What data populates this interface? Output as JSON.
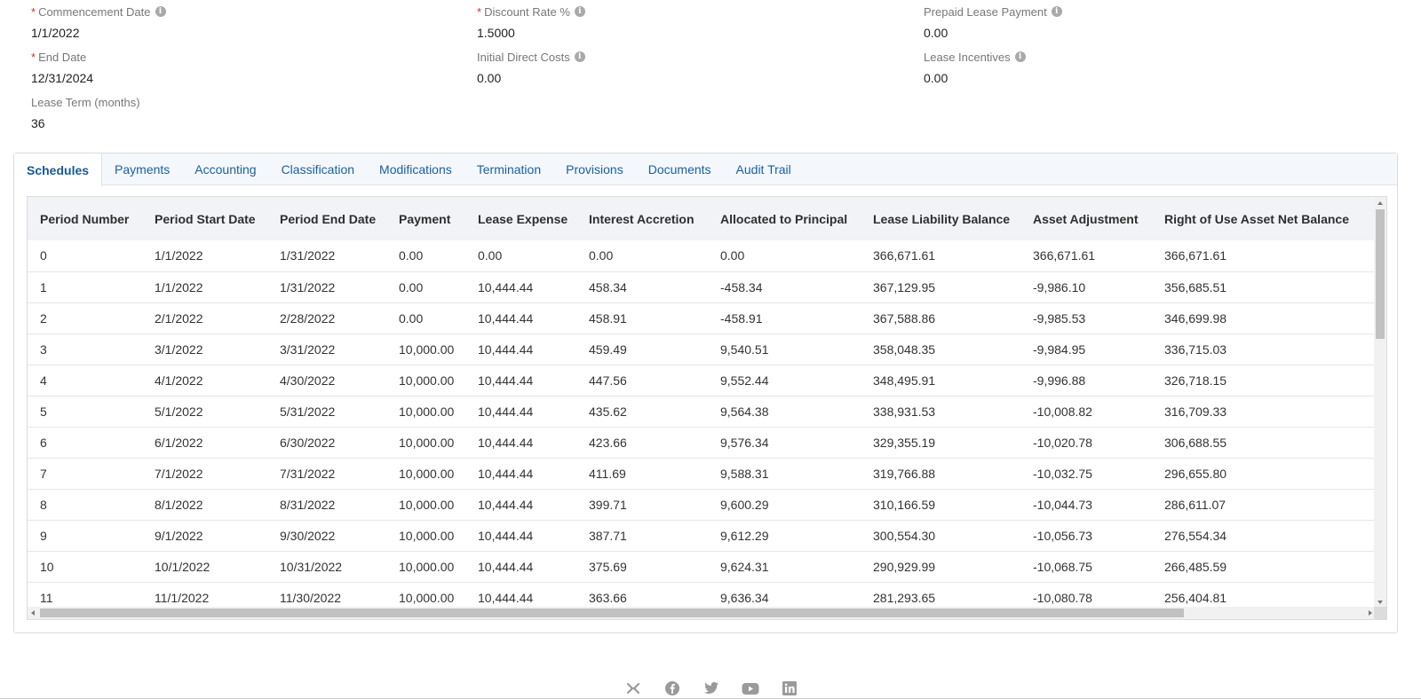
{
  "fields": {
    "commencement_date": {
      "label": "Commencement Date",
      "value": "1/1/2022"
    },
    "discount_rate": {
      "label": "Discount Rate %",
      "value": "1.5000"
    },
    "prepaid_lease_payment": {
      "label": "Prepaid Lease Payment",
      "value": "0.00"
    },
    "end_date": {
      "label": "End Date",
      "value": "12/31/2024"
    },
    "initial_direct_costs": {
      "label": "Initial Direct Costs",
      "value": "0.00"
    },
    "lease_incentives": {
      "label": "Lease Incentives",
      "value": "0.00"
    },
    "lease_term": {
      "label": "Lease Term (months)",
      "value": "36"
    },
    "required_marker": "*",
    "info_glyph": "i"
  },
  "tabs": [
    "Schedules",
    "Payments",
    "Accounting",
    "Classification",
    "Modifications",
    "Termination",
    "Provisions",
    "Documents",
    "Audit Trail"
  ],
  "table": {
    "columns": [
      "Period Number",
      "Period Start Date",
      "Period End Date",
      "Payment",
      "Lease Expense",
      "Interest Accretion",
      "Allocated to Principal",
      "Lease Liability Balance",
      "Asset Adjustment",
      "Right of Use Asset Net Balance"
    ],
    "rows": [
      [
        "0",
        "1/1/2022",
        "1/31/2022",
        "0.00",
        "0.00",
        "0.00",
        "0.00",
        "366,671.61",
        "366,671.61",
        "366,671.61"
      ],
      [
        "1",
        "1/1/2022",
        "1/31/2022",
        "0.00",
        "10,444.44",
        "458.34",
        "-458.34",
        "367,129.95",
        "-9,986.10",
        "356,685.51"
      ],
      [
        "2",
        "2/1/2022",
        "2/28/2022",
        "0.00",
        "10,444.44",
        "458.91",
        "-458.91",
        "367,588.86",
        "-9,985.53",
        "346,699.98"
      ],
      [
        "3",
        "3/1/2022",
        "3/31/2022",
        "10,000.00",
        "10,444.44",
        "459.49",
        "9,540.51",
        "358,048.35",
        "-9,984.95",
        "336,715.03"
      ],
      [
        "4",
        "4/1/2022",
        "4/30/2022",
        "10,000.00",
        "10,444.44",
        "447.56",
        "9,552.44",
        "348,495.91",
        "-9,996.88",
        "326,718.15"
      ],
      [
        "5",
        "5/1/2022",
        "5/31/2022",
        "10,000.00",
        "10,444.44",
        "435.62",
        "9,564.38",
        "338,931.53",
        "-10,008.82",
        "316,709.33"
      ],
      [
        "6",
        "6/1/2022",
        "6/30/2022",
        "10,000.00",
        "10,444.44",
        "423.66",
        "9,576.34",
        "329,355.19",
        "-10,020.78",
        "306,688.55"
      ],
      [
        "7",
        "7/1/2022",
        "7/31/2022",
        "10,000.00",
        "10,444.44",
        "411.69",
        "9,588.31",
        "319,766.88",
        "-10,032.75",
        "296,655.80"
      ],
      [
        "8",
        "8/1/2022",
        "8/31/2022",
        "10,000.00",
        "10,444.44",
        "399.71",
        "9,600.29",
        "310,166.59",
        "-10,044.73",
        "286,611.07"
      ],
      [
        "9",
        "9/1/2022",
        "9/30/2022",
        "10,000.00",
        "10,444.44",
        "387.71",
        "9,612.29",
        "300,554.30",
        "-10,056.73",
        "276,554.34"
      ],
      [
        "10",
        "10/1/2022",
        "10/31/2022",
        "10,000.00",
        "10,444.44",
        "375.69",
        "9,624.31",
        "290,929.99",
        "-10,068.75",
        "266,485.59"
      ],
      [
        "11",
        "11/1/2022",
        "11/30/2022",
        "10,000.00",
        "10,444.44",
        "363.66",
        "9,636.34",
        "281,293.65",
        "-10,080.78",
        "256,404.81"
      ]
    ]
  },
  "footer": {
    "icons": [
      "x-logo-icon",
      "facebook-icon",
      "twitter-icon",
      "youtube-icon",
      "linkedin-icon"
    ]
  }
}
